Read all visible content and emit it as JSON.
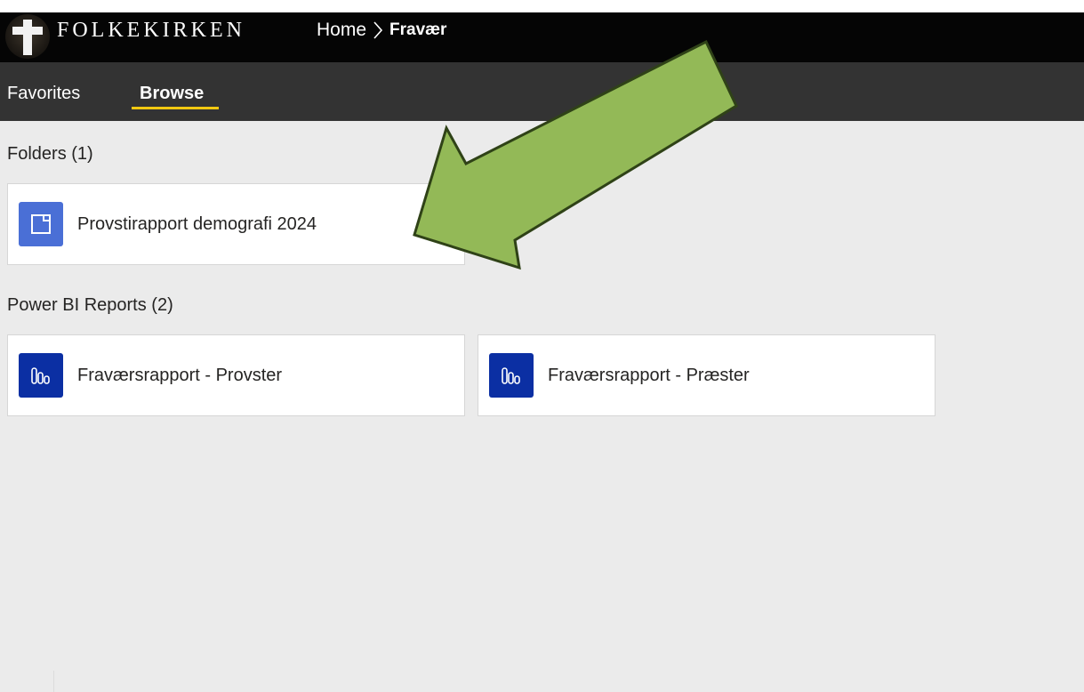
{
  "header": {
    "brand": "FOLKEKIRKEN",
    "breadcrumb": {
      "home": "Home",
      "current": "Fravær"
    }
  },
  "nav": {
    "tabs": [
      {
        "label": "Favorites",
        "active": false
      },
      {
        "label": "Browse",
        "active": true
      }
    ],
    "active_underline_color": "#f2c811"
  },
  "sections": {
    "folders": {
      "title": "Folders (1)",
      "items": [
        {
          "label": "Provstirapport demografi 2024",
          "icon": "folder-icon"
        }
      ]
    },
    "reports": {
      "title": "Power BI Reports (2)",
      "items": [
        {
          "label": "Fraværsrapport - Provster",
          "icon": "power-bi-report-icon"
        },
        {
          "label": "Fraværsrapport - Præster",
          "icon": "power-bi-report-icon"
        }
      ]
    }
  },
  "annotation": {
    "type": "green-arrow",
    "color": "#93b957"
  },
  "colors": {
    "topbar": "#050505",
    "navbar": "#333333",
    "content": "#ebebeb",
    "folder_icon": "#4a6fd6",
    "report_icon": "#0b2fa3"
  }
}
